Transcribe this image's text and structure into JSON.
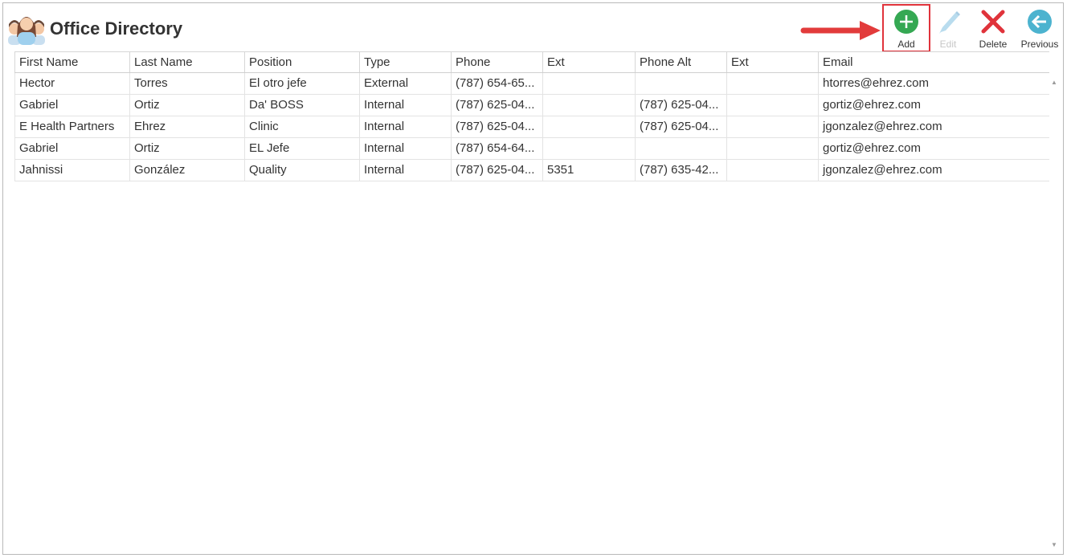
{
  "window": {
    "title": "Office Directory"
  },
  "toolbar": {
    "add_label": "Add",
    "edit_label": "Edit",
    "delete_label": "Delete",
    "previous_label": "Previous"
  },
  "colors": {
    "add": "#35a853",
    "delete": "#e0333b",
    "previous": "#4cb3cf",
    "edit": "#b9dcee",
    "highlight": "#e0333b"
  },
  "grid": {
    "columns": [
      "First Name",
      "Last Name",
      "Position",
      "Type",
      "Phone",
      "Ext",
      "Phone Alt",
      "Ext",
      "Email"
    ],
    "rows": [
      [
        "Hector",
        "Torres",
        "El otro jefe",
        "External",
        "(787) 654-65...",
        "",
        "",
        "",
        "htorres@ehrez.com"
      ],
      [
        "Gabriel",
        "Ortiz",
        "Da' BOSS",
        "Internal",
        "(787) 625-04...",
        "",
        "(787) 625-04...",
        "",
        "gortiz@ehrez.com"
      ],
      [
        "E Health Partners",
        "Ehrez",
        "Clinic",
        "Internal",
        "(787) 625-04...",
        "",
        "(787) 625-04...",
        "",
        "jgonzalez@ehrez.com"
      ],
      [
        "Gabriel",
        "Ortiz",
        "EL Jefe",
        "Internal",
        "(787) 654-64...",
        "",
        "",
        "",
        "gortiz@ehrez.com"
      ],
      [
        "Jahnissi",
        "González",
        "Quality",
        "Internal",
        "(787) 625-04...",
        "5351",
        "(787) 635-42...",
        "",
        "jgonzalez@ehrez.com"
      ]
    ]
  }
}
